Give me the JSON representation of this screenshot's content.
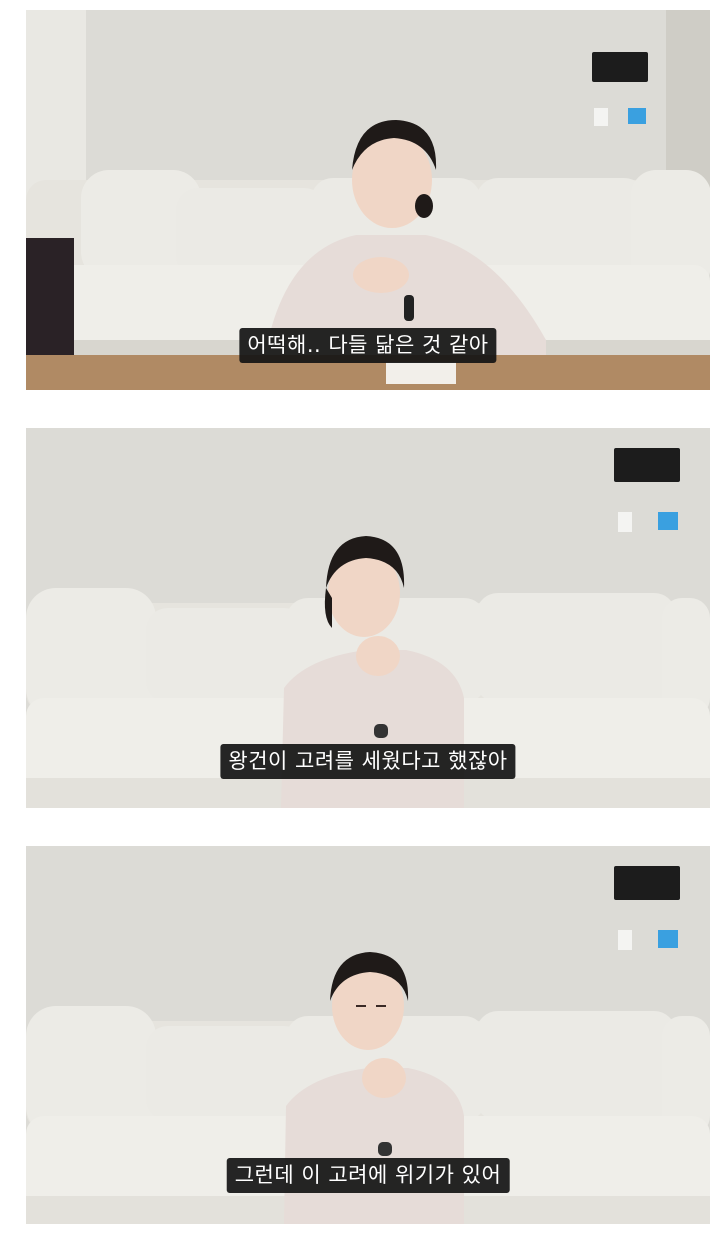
{
  "frames": [
    {
      "subtitle": "어떡해.. 다들 닮은 것 같아",
      "scene": "woman-talking-gesturing"
    },
    {
      "subtitle": "왕건이 고려를 세웠다고 했잖아",
      "scene": "woman-thinking-chin-on-hand"
    },
    {
      "subtitle": "그런데 이 고려에 위기가 있어",
      "scene": "woman-eyes-closed-chin-on-hand"
    }
  ],
  "colors": {
    "wall": "#dcdbd6",
    "sofa": "#ecebe6",
    "sofa_shadow": "#cfcdc6",
    "table": "#b08a64",
    "sweater": "#e6dcd8",
    "hair": "#1f1a18",
    "skin": "#f0d6c6",
    "subtitle_bg": "#141414",
    "subtitle_text": "#ffffff",
    "switch_blue": "#3aa0e0"
  }
}
